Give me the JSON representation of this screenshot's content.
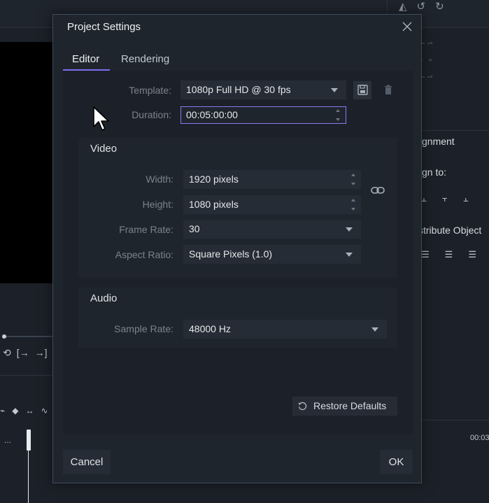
{
  "background": {
    "right_panel": {
      "alignment_label": "gnment",
      "align_to_label": "gn to:",
      "distribute_label": "stribute Object",
      "timecode": "00:03"
    },
    "timeline": {
      "dots": "..."
    }
  },
  "dialog": {
    "title": "Project Settings",
    "tabs": [
      {
        "label": "Editor",
        "active": true
      },
      {
        "label": "Rendering",
        "active": false
      }
    ],
    "template": {
      "label": "Template:",
      "value": "1080p Full HD @ 30 fps"
    },
    "duration": {
      "label": "Duration:",
      "value": "00:05:00:00"
    },
    "video": {
      "title": "Video",
      "width": {
        "label": "Width:",
        "value": "1920 pixels"
      },
      "height": {
        "label": "Height:",
        "value": "1080 pixels"
      },
      "frame_rate": {
        "label": "Frame Rate:",
        "value": "30"
      },
      "aspect_ratio": {
        "label": "Aspect Ratio:",
        "value": "Square Pixels (1.0)"
      }
    },
    "audio": {
      "title": "Audio",
      "sample_rate": {
        "label": "Sample Rate:",
        "value": "48000 Hz"
      }
    },
    "restore_defaults_label": "Restore Defaults",
    "cancel_label": "Cancel",
    "ok_label": "OK"
  },
  "colors": {
    "accent": "#7c6cf0",
    "dialog_bg": "#1f252d",
    "field_bg": "#262c35",
    "dialog_border": "#3f4a5a"
  },
  "icons": [
    "close-icon",
    "save-icon",
    "trash-icon",
    "link-icon",
    "restore-icon",
    "chevron-down-icon",
    "spinner-arrows-icon",
    "mouse-cursor-icon"
  ]
}
